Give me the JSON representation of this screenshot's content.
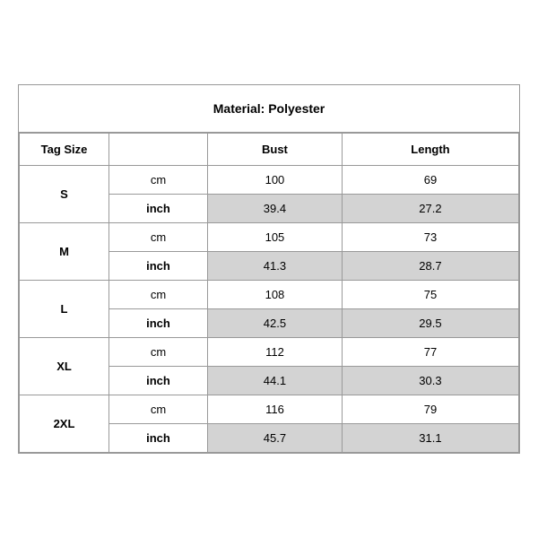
{
  "title": "Material: Polyester",
  "header": {
    "tag_size": "Tag Size",
    "bust": "Bust",
    "length": "Length"
  },
  "sizes": [
    {
      "tag": "S",
      "cm_bust": "100",
      "cm_length": "69",
      "inch_bust": "39.4",
      "inch_length": "27.2"
    },
    {
      "tag": "M",
      "cm_bust": "105",
      "cm_length": "73",
      "inch_bust": "41.3",
      "inch_length": "28.7"
    },
    {
      "tag": "L",
      "cm_bust": "108",
      "cm_length": "75",
      "inch_bust": "42.5",
      "inch_length": "29.5"
    },
    {
      "tag": "XL",
      "cm_bust": "112",
      "cm_length": "77",
      "inch_bust": "44.1",
      "inch_length": "30.3"
    },
    {
      "tag": "2XL",
      "cm_bust": "116",
      "cm_length": "79",
      "inch_bust": "45.7",
      "inch_length": "31.1"
    }
  ],
  "units": {
    "cm": "cm",
    "inch": "inch"
  }
}
